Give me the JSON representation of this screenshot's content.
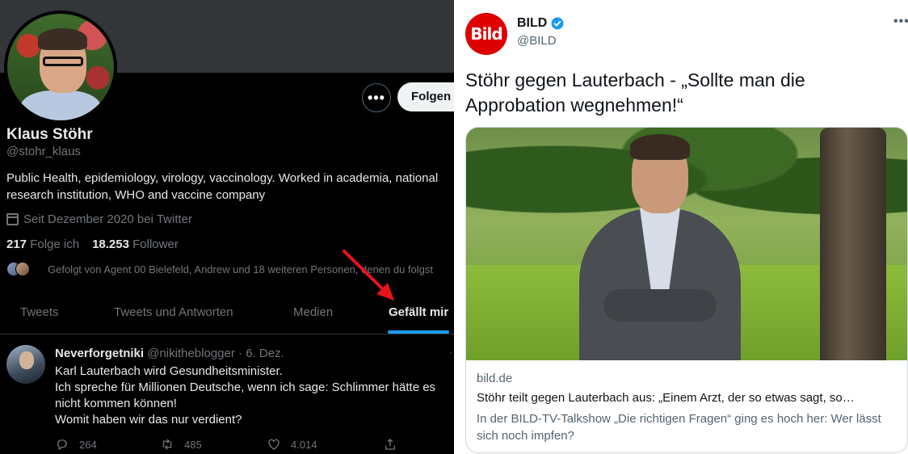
{
  "profile": {
    "name": "Klaus Stöhr",
    "handle": "@stohr_klaus",
    "bio": "Public Health, epidemiology, virology, vaccinology. Worked in academia, national research institution, WHO and vaccine company",
    "joined": "Seit Dezember 2020 bei Twitter",
    "following_count": "217",
    "following_label": "Folge ich",
    "followers_count": "18.253",
    "followers_label": "Follower",
    "followed_by": "Gefolgt von Agent 00 Bielefeld, Andrew und 18 weiteren Personen, denen du folgst",
    "more_label": "•••",
    "follow_label": "Folgen"
  },
  "tabs": [
    {
      "label": "Tweets",
      "active": false
    },
    {
      "label": "Tweets und Antworten",
      "active": false
    },
    {
      "label": "Medien",
      "active": false
    },
    {
      "label": "Gefällt mir",
      "active": true
    }
  ],
  "tweet": {
    "author": "Neverforgetniki",
    "handle": "@nikitheblogger",
    "sep": "·",
    "date": "6. Dez.",
    "text_lines": [
      "Karl Lauterbach wird Gesundheitsminister.",
      "Ich spreche für Millionen Deutsche, wenn ich sage: Schlimmer hätte es nicht kommen können!",
      "Womit haben wir das nur verdient?"
    ],
    "replies": "264",
    "retweets": "485",
    "likes": "4.014"
  },
  "bild": {
    "logo_text": "Bild",
    "name": "BILD",
    "handle": "@BILD",
    "more_label": "•••",
    "headline": "Stöhr gegen Lauterbach - „Sollte man die Approbation wegnehmen!“",
    "card": {
      "domain": "bild.de",
      "title": "Stöhr teilt gegen Lauterbach aus: „Einem Arzt, der so etwas sagt, so…",
      "description": "In der BILD-TV-Talkshow „Die richtigen Fragen“ ging es hoch her: Wer lässt sich noch impfen?"
    }
  },
  "colors": {
    "accent": "#1d9bf0",
    "annotation_arrow": "#e8141c",
    "bild_red": "#de0000"
  },
  "icons": [
    "calendar-icon",
    "reply-icon",
    "retweet-icon",
    "like-icon",
    "share-icon",
    "verified-badge-icon",
    "red-arrow-annotation"
  ]
}
